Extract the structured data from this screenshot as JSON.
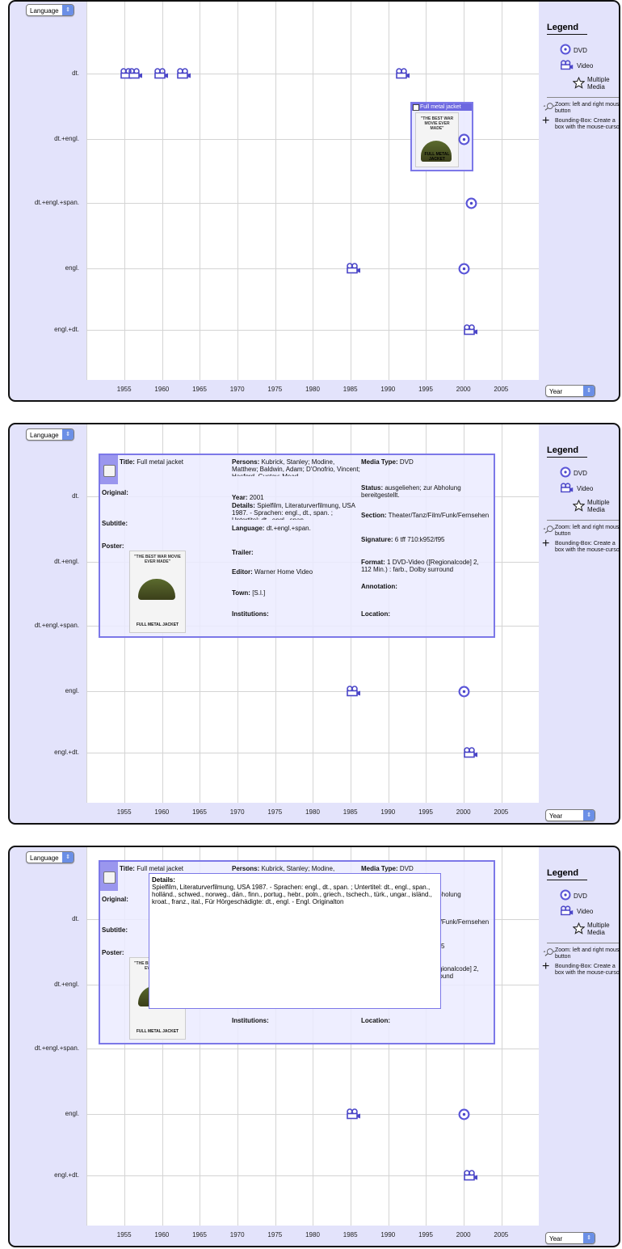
{
  "controls": {
    "y_select": "Language",
    "x_select": "Year",
    "arrow": "⇕"
  },
  "axis": {
    "y_labels": [
      "dt.",
      "dt.+engl.",
      "dt.+engl.+span.",
      "engl.",
      "engl.+dt."
    ],
    "x_labels": [
      "1955",
      "1960",
      "1965",
      "1970",
      "1975",
      "1980",
      "1985",
      "1990",
      "1995",
      "2000",
      "2005"
    ]
  },
  "legend": {
    "title": "Legend",
    "items": [
      {
        "icon": "dvd-icon",
        "label": "DVD"
      },
      {
        "icon": "video-icon",
        "label": "Video"
      },
      {
        "icon": "star-icon",
        "label": "Multiple Media"
      }
    ],
    "hints": [
      {
        "icon": "zoom-icon",
        "text": "Zoom: left and right mouse button"
      },
      {
        "icon": "crosshair-icon",
        "text": "Bounding-Box: Create a box with the mouse-cursor"
      }
    ]
  },
  "hover_card": {
    "title": "Full metal jacket"
  },
  "detail": {
    "title_label": "Title:",
    "title_value": "Full metal jacket",
    "original_label": "Original:",
    "subtitle_label": "Subtitle:",
    "poster_label": "Poster:",
    "persons_label": "Persons:",
    "persons_value": "Kubrick, Stanley; Modine, Matthew; Baldwin, Adam; D'Onofrio, Vincent; Hasford, Gustav; Mead",
    "year_label": "Year:",
    "year_value": "2001",
    "details_label": "Details:",
    "details_value": "Spielfilm, Literaturverfilmung, USA 1987. - Sprachen: engl., dt., span. ; Untertitel: dt., engl., span.",
    "language_label": "Language:",
    "language_value": "dt.+engl.+span.",
    "trailer_label": "Trailer:",
    "editor_label": "Editor:",
    "editor_value": "Warner Home Video",
    "town_label": "Town:",
    "town_value": "[S.l.]",
    "institutions_label": "Institutions:",
    "media_label": "Media Type:",
    "media_value": "DVD",
    "status_label": "Status:",
    "status_value": "ausgeliehen; zur Abholung bereitgestellt.",
    "section_label": "Section:",
    "section_value": "Theater/Tanz/Film/Funk/Fernsehen",
    "signature_label": "Signature:",
    "signature_value": "6 tff 710:k952/f95",
    "format_label": "Format:",
    "format_value": "1 DVD-Video ([Regionalcode] 2, 112 Min.) : farb., Dolby surround",
    "annotation_label": "Annotation:",
    "location_label": "Location:"
  },
  "details_popup": {
    "label": "Details:",
    "text": "Spielfilm, Literaturverfilmung, USA 1987. - Sprachen: engl., dt., span. ; Untertitel: dt., engl., span., holländ., schwed., norweg., dän., finn., portug., hebr., poln., griech., tschech., türk., ungar., isländ., kroat., franz., ital., Für Hörgeschädigte: dt., engl. - Engl. Originalton"
  },
  "poster": {
    "top": "\"THE BEST WAR MOVIE EVER MADE\"",
    "bottom": "FULL METAL JACKET"
  },
  "marks": [
    {
      "type": "video",
      "year": 1955.5,
      "lang": 0
    },
    {
      "type": "video",
      "year": 1956.5,
      "lang": 0
    },
    {
      "type": "video",
      "year": 1960,
      "lang": 0
    },
    {
      "type": "video",
      "year": 1963,
      "lang": 0
    },
    {
      "type": "video",
      "year": 1992,
      "lang": 0
    },
    {
      "type": "dvd",
      "year": 2000,
      "lang": 1
    },
    {
      "type": "dvd",
      "year": 2001,
      "lang": 2
    },
    {
      "type": "video",
      "year": 1985.5,
      "lang": 3
    },
    {
      "type": "dvd",
      "year": 2000,
      "lang": 3
    },
    {
      "type": "video",
      "year": 2001,
      "lang": 4
    }
  ],
  "colors": {
    "accent": "#5b56d8",
    "panel": "#e3e3fb"
  }
}
